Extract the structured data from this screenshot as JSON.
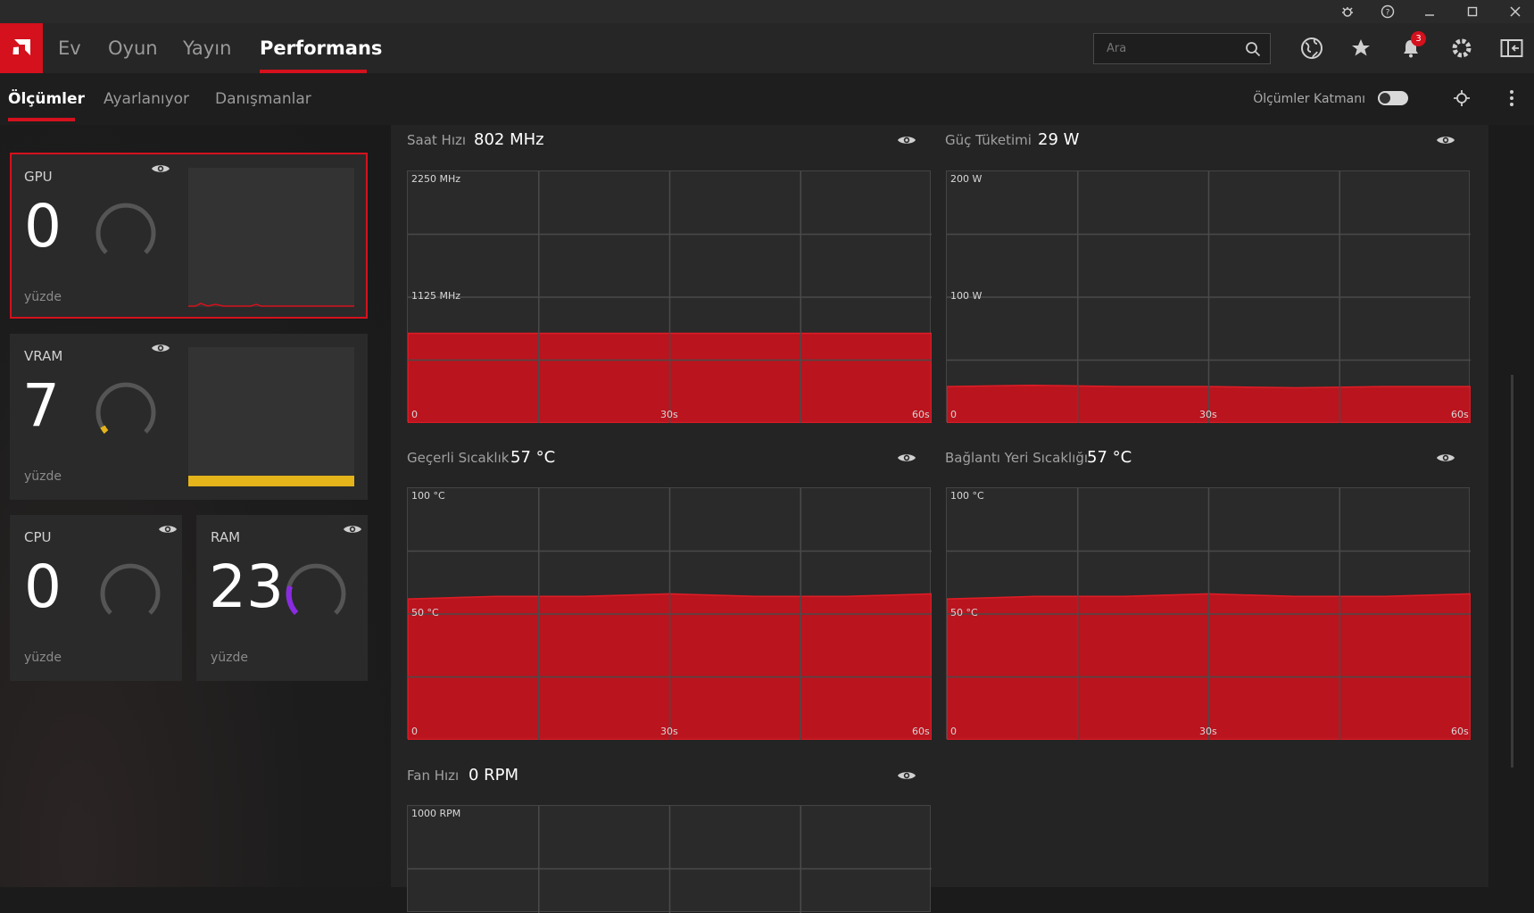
{
  "app": {
    "nav_tabs": [
      "Ev",
      "Oyun",
      "Yayın",
      "Performans"
    ],
    "active_nav": "Performans",
    "search_placeholder": "Ara",
    "notification_count": "3",
    "accent_color": "#d4111c"
  },
  "subnav": {
    "tabs": [
      "Ölçümler",
      "Ayarlanıyor",
      "Danışmanlar"
    ],
    "active": "Ölçümler",
    "overlay_label": "Ölçümler Katmanı",
    "overlay_enabled": false
  },
  "gauges": [
    {
      "label": "GPU",
      "value": "0",
      "unit": "yüzde",
      "color": "#d4111c"
    },
    {
      "label": "VRAM",
      "value": "7",
      "unit": "yüzde",
      "color": "#e5b31a"
    },
    {
      "label": "CPU",
      "value": "0",
      "unit": "yüzde",
      "color": "#777777"
    },
    {
      "label": "RAM",
      "value": "23",
      "unit": "yüzde",
      "color": "#8a2be2"
    }
  ],
  "metrics": [
    {
      "title": "Saat Hızı",
      "value": "802 MHz",
      "ymax_label": "2250 MHz",
      "ymid_label": "1125 MHz",
      "x_labels": [
        "0",
        "30s",
        "60s"
      ]
    },
    {
      "title": "Güç Tüketimi",
      "value": "29 W",
      "ymax_label": "200 W",
      "ymid_label": "100 W",
      "x_labels": [
        "0",
        "30s",
        "60s"
      ]
    },
    {
      "title": "Geçerli Sıcaklık",
      "value": "57 °C",
      "ymax_label": "100 °C",
      "ymid_label": "50 °C",
      "x_labels": [
        "0",
        "30s",
        "60s"
      ]
    },
    {
      "title": "Bağlantı Yeri Sıcaklığı",
      "value": "57 °C",
      "ymax_label": "100 °C",
      "ymid_label": "50 °C",
      "x_labels": [
        "0",
        "30s",
        "60s"
      ]
    },
    {
      "title": "Fan Hızı",
      "value": "0 RPM",
      "ymax_label": "1000 RPM",
      "ymid_label": "",
      "x_labels": []
    }
  ],
  "series": {
    "clock": [
      802,
      802,
      802,
      802,
      802,
      802,
      802
    ],
    "power": [
      29,
      30,
      29,
      29,
      28,
      29,
      29
    ],
    "temp": [
      56,
      57,
      57,
      58,
      57,
      57,
      58
    ],
    "hotspot": [
      56,
      57,
      57,
      58,
      57,
      57,
      58
    ]
  }
}
